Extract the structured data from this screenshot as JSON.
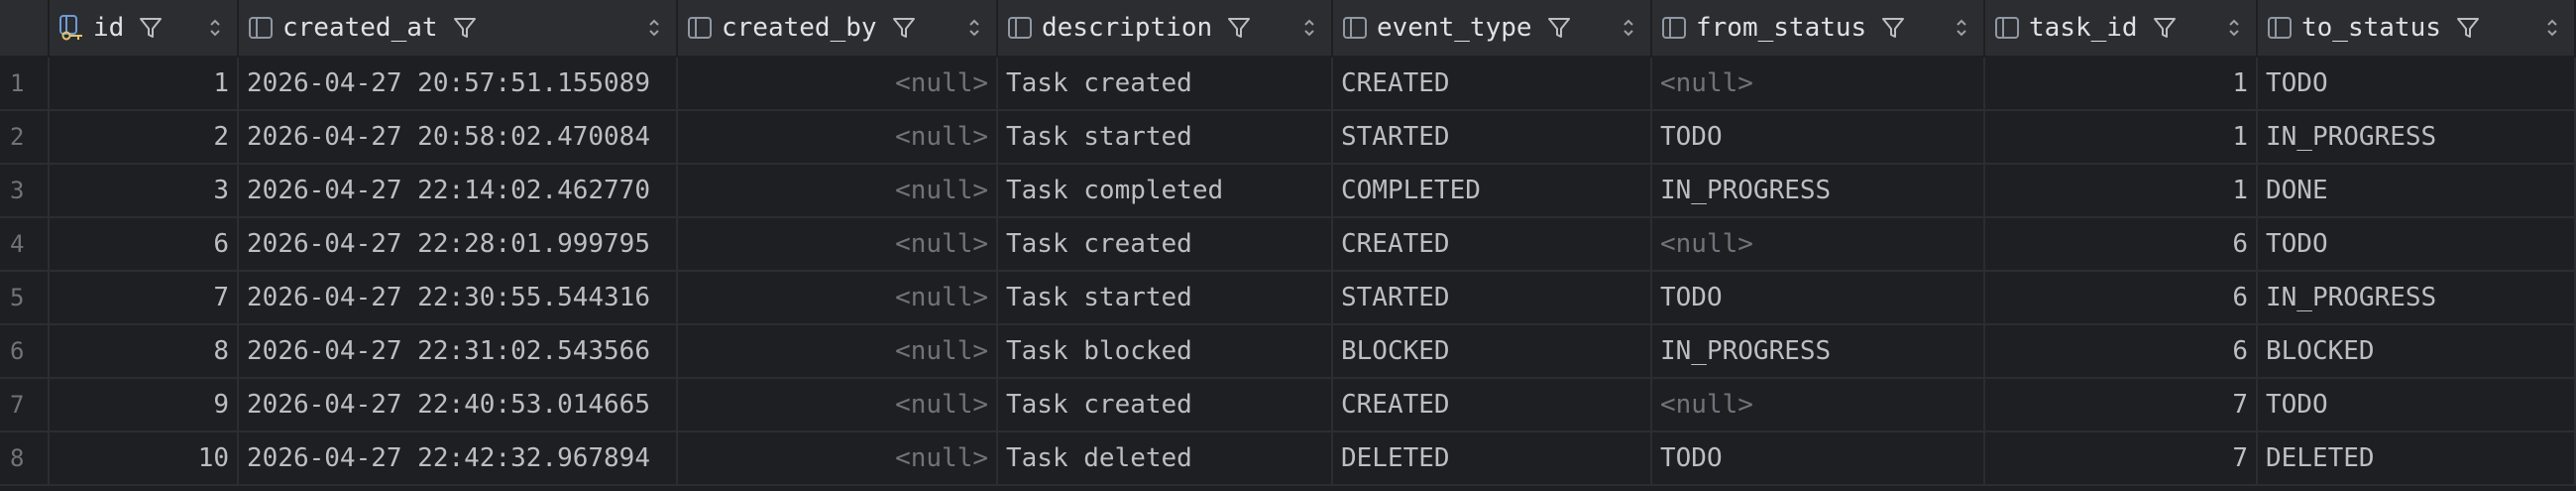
{
  "columns": [
    {
      "name": "id",
      "icon": "primary-key-column-icon"
    },
    {
      "name": "created_at",
      "icon": "column-icon"
    },
    {
      "name": "created_by",
      "icon": "column-icon"
    },
    {
      "name": "description",
      "icon": "column-icon"
    },
    {
      "name": "event_type",
      "icon": "column-icon"
    },
    {
      "name": "from_status",
      "icon": "column-icon"
    },
    {
      "name": "task_id",
      "icon": "column-icon"
    },
    {
      "name": "to_status",
      "icon": "column-icon"
    }
  ],
  "null_text": "<null>",
  "rows": [
    {
      "num": "1",
      "id": "1",
      "created_at": "2026-04-27 20:57:51.155089",
      "created_by": null,
      "description": "Task created",
      "event_type": "CREATED",
      "from_status": null,
      "task_id": "1",
      "to_status": "TODO"
    },
    {
      "num": "2",
      "id": "2",
      "created_at": "2026-04-27 20:58:02.470084",
      "created_by": null,
      "description": "Task started",
      "event_type": "STARTED",
      "from_status": "TODO",
      "task_id": "1",
      "to_status": "IN_PROGRESS"
    },
    {
      "num": "3",
      "id": "3",
      "created_at": "2026-04-27 22:14:02.462770",
      "created_by": null,
      "description": "Task completed",
      "event_type": "COMPLETED",
      "from_status": "IN_PROGRESS",
      "task_id": "1",
      "to_status": "DONE"
    },
    {
      "num": "4",
      "id": "6",
      "created_at": "2026-04-27 22:28:01.999795",
      "created_by": null,
      "description": "Task created",
      "event_type": "CREATED",
      "from_status": null,
      "task_id": "6",
      "to_status": "TODO"
    },
    {
      "num": "5",
      "id": "7",
      "created_at": "2026-04-27 22:30:55.544316",
      "created_by": null,
      "description": "Task started",
      "event_type": "STARTED",
      "from_status": "TODO",
      "task_id": "6",
      "to_status": "IN_PROGRESS"
    },
    {
      "num": "6",
      "id": "8",
      "created_at": "2026-04-27 22:31:02.543566",
      "created_by": null,
      "description": "Task blocked",
      "event_type": "BLOCKED",
      "from_status": "IN_PROGRESS",
      "task_id": "6",
      "to_status": "BLOCKED"
    },
    {
      "num": "7",
      "id": "9",
      "created_at": "2026-04-27 22:40:53.014665",
      "created_by": null,
      "description": "Task created",
      "event_type": "CREATED",
      "from_status": null,
      "task_id": "7",
      "to_status": "TODO"
    },
    {
      "num": "8",
      "id": "10",
      "created_at": "2026-04-27 22:42:32.967894",
      "created_by": null,
      "description": "Task deleted",
      "event_type": "DELETED",
      "from_status": "TODO",
      "task_id": "7",
      "to_status": "DELETED"
    }
  ],
  "colors": {
    "background": "#1e1f22",
    "header_bg": "#2b2d30",
    "text": "#bcbec4",
    "muted": "#6f737a",
    "key_icon": "#e2c467",
    "column_icon": "#8f98a3"
  }
}
